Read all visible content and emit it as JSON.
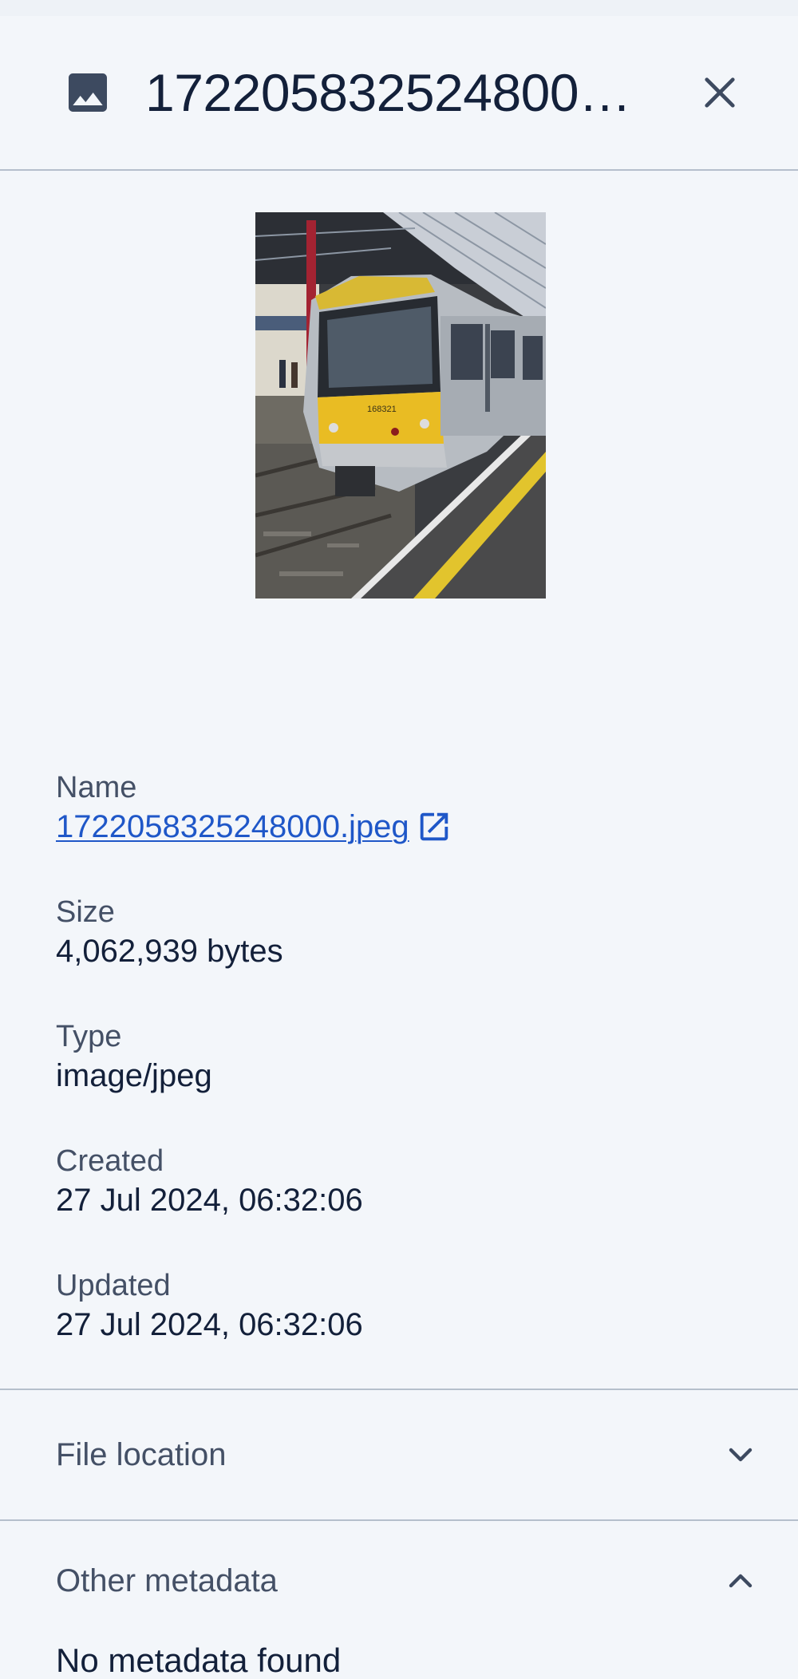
{
  "header": {
    "title": "172205832524800…",
    "file_icon": "image-icon",
    "close_icon": "close-icon"
  },
  "preview": {
    "description_icon": "image-preview"
  },
  "details": {
    "name_label": "Name",
    "name_value": "1722058325248000.jpeg",
    "size_label": "Size",
    "size_value": "4,062,939 bytes",
    "type_label": "Type",
    "type_value": "image/jpeg",
    "created_label": "Created",
    "created_value": "27 Jul 2024, 06:32:06",
    "updated_label": "Updated",
    "updated_value": "27 Jul 2024, 06:32:06"
  },
  "sections": {
    "file_location": "File location",
    "other_metadata": "Other metadata",
    "no_metadata": "No metadata found"
  },
  "colors": {
    "background": "#f3f6fa",
    "text": "#13203a",
    "muted": "#445066",
    "link": "#1f57c8",
    "divider": "#b5bfcc"
  }
}
